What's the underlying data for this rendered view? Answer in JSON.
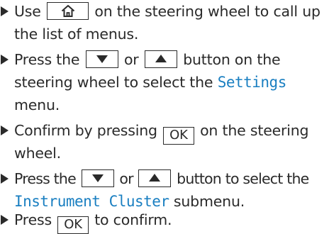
{
  "steps": [
    {
      "lines": [
        {
          "a": "Use",
          "b": "on the steering wheel to call up"
        },
        {
          "a": "the list of menus."
        }
      ]
    },
    {
      "lines": [
        {
          "a": "Press the",
          "or": "or",
          "b": "button on the"
        },
        {
          "a": "steering wheel to select the",
          "menu": "Settings"
        },
        {
          "a": "menu."
        }
      ]
    },
    {
      "lines": [
        {
          "a": "Confirm by pressing",
          "key": "OK",
          "b": "on the steering"
        },
        {
          "a": "wheel."
        }
      ]
    },
    {
      "lines": [
        {
          "a": "Press the",
          "or": "or",
          "b": "button to select the"
        },
        {
          "menu": "Instrument Cluster",
          "b": "submenu."
        }
      ]
    },
    {
      "lines": [
        {
          "a": "Press",
          "key": "OK",
          "b": "to confirm."
        }
      ]
    }
  ],
  "icons": {
    "bullet": "triangle-right-icon",
    "home": "home-icon",
    "down": "triangle-down-icon",
    "up": "triangle-up-icon"
  },
  "colors": {
    "text": "#2a2a2a",
    "display_text": "#1a7fc1"
  }
}
